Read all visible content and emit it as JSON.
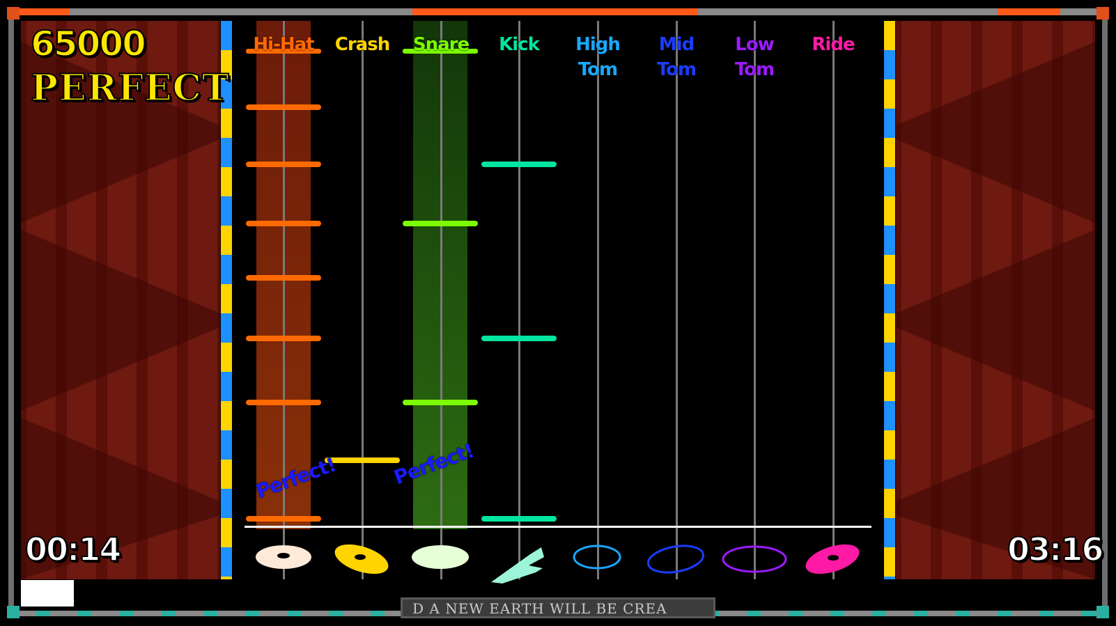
{
  "hud": {
    "score": "65000",
    "rating": "PERFECT",
    "elapsed_time": "00:14",
    "total_time": "03:16"
  },
  "lanes": [
    {
      "label": "Hi-Hat",
      "color": "#ff6a00",
      "drum_icon": "hihat-cymbal-icon"
    },
    {
      "label": "Crash",
      "color": "#ffd400",
      "drum_icon": "crash-cymbal-icon"
    },
    {
      "label": "Snare",
      "color": "#7cfc00",
      "drum_icon": "snare-drum-icon"
    },
    {
      "label": "Kick",
      "color": "#00e5a0",
      "drum_icon": "kick-pedal-icon"
    },
    {
      "label": "High Tom",
      "color": "#18a8ff",
      "drum_icon": "high-tom-icon"
    },
    {
      "label": "Mid Tom",
      "color": "#1a3cff",
      "drum_icon": "mid-tom-icon"
    },
    {
      "label": "Low Tom",
      "color": "#9b1bff",
      "drum_icon": "low-tom-icon"
    },
    {
      "label": "Ride",
      "color": "#ff1aa6",
      "drum_icon": "ride-cymbal-icon"
    }
  ],
  "judgements": [
    {
      "text": "Perfect!",
      "lane": "Hi-Hat"
    },
    {
      "text": "Perfect!",
      "lane": "Snare"
    }
  ],
  "lyrics_marquee": "D A NEW EARTH WILL BE CREA"
}
